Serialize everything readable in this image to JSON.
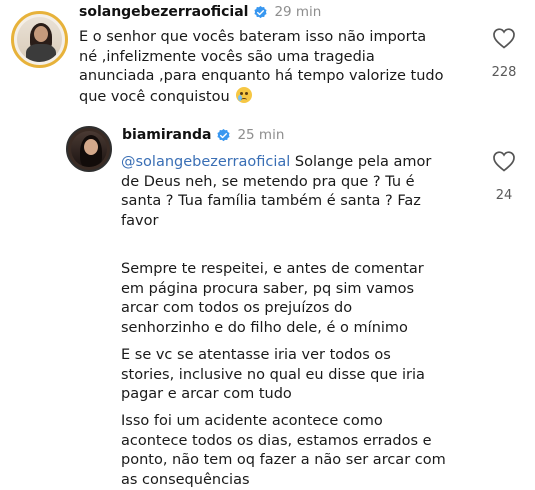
{
  "comment1": {
    "username": "solangebezerraoficial",
    "time": "29 min",
    "lines": [
      "E o senhor que vocês bateram isso não importa",
      "né ,infelizmente vocês são uma tragedia",
      "anunciada ,para enquanto há tempo valorize tudo",
      "que você conquistou"
    ],
    "emoji": "crying-face",
    "likes": "228"
  },
  "comment2": {
    "username": "biamiranda",
    "time": "25 min",
    "mention": "@solangebezerraoficial",
    "line1_rest": " Solange pela amor",
    "lines": [
      "de Deus neh, se metendo pra que ? Tu é",
      "santa ? Tua família também é santa ? Faz",
      "favor"
    ],
    "likes": "24",
    "paragraph1": [
      "Sempre te respeitei, e antes de comentar",
      "em página procura saber, pq sim vamos",
      "arcar com todos os prejuízos do",
      "senhorzinho e do filho dele, é o mínimo"
    ],
    "paragraph2": [
      "E se vc se atentasse iria ver todos os",
      "stories, inclusive no qual eu disse que iria",
      "pagar e arcar com tudo"
    ],
    "paragraph3": [
      "Isso foi um acidente acontece como",
      "acontece todos os dias, estamos errados e",
      "ponto, não tem oq fazer a não ser arcar com",
      "as consequências"
    ]
  },
  "colors": {
    "verified": "#3897f0",
    "mention": "#3a6fb5",
    "muted": "#8e8e8e",
    "avatar_ring": "#e7b23a"
  }
}
